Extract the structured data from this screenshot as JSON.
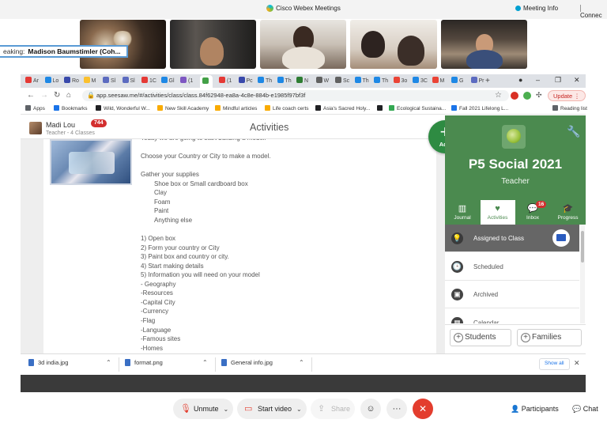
{
  "webex": {
    "title": "Cisco Webex Meetings",
    "meeting_info": "Meeting Info",
    "connection": "Connec",
    "speaking_prefix": "eaking:",
    "speaking_name": "Madison Baumstimler (Coh..."
  },
  "browser": {
    "tabs": [
      {
        "label": "Ar",
        "color": "#e53935"
      },
      {
        "label": "Lo",
        "color": "#1e88e5"
      },
      {
        "label": "Ro",
        "color": "#3949ab"
      },
      {
        "label": "M",
        "color": "#fbc02d"
      },
      {
        "label": "Sl",
        "color": "#5c6bc0"
      },
      {
        "label": "Sl",
        "color": "#5c6bc0"
      },
      {
        "label": "1C",
        "color": "#e53935"
      },
      {
        "label": "Gl",
        "color": "#1e88e5"
      },
      {
        "label": "(1",
        "color": "#7e57c2"
      },
      {
        "label": "",
        "color": "#43a047"
      },
      {
        "label": "(1",
        "color": "#e53935"
      },
      {
        "label": "Pc",
        "color": "#3949ab"
      },
      {
        "label": "Th",
        "color": "#1e88e5"
      },
      {
        "label": "Th",
        "color": "#1e88e5"
      },
      {
        "label": "N",
        "color": "#2e7d32"
      },
      {
        "label": "W",
        "color": "#616161"
      },
      {
        "label": "Sc",
        "color": "#616161"
      },
      {
        "label": "Th",
        "color": "#1e88e5"
      },
      {
        "label": "Th",
        "color": "#1e88e5"
      },
      {
        "label": "3o",
        "color": "#ea4335"
      },
      {
        "label": "3C",
        "color": "#1e88e5"
      },
      {
        "label": "M",
        "color": "#ea4335"
      },
      {
        "label": "G",
        "color": "#1e88e5"
      },
      {
        "label": "Pr",
        "color": "#5c6bc0"
      }
    ],
    "new_tab": "+",
    "url": "app.seesaw.me/#/activities/class/class.84f62948-ea8a-4c8e-884b-e1985f97bf3f",
    "update_label": "Update",
    "bookmarks": [
      {
        "label": "Apps",
        "color": "#5f6368"
      },
      {
        "label": "Bookmarks",
        "color": "#1a73e8"
      },
      {
        "label": "Wild, Wonderful W...",
        "color": "#202124"
      },
      {
        "label": "New Skill Academy",
        "color": "#f9ab00"
      },
      {
        "label": "Mindful articles",
        "color": "#f9ab00"
      },
      {
        "label": "Life coach certs",
        "color": "#f9ab00"
      },
      {
        "label": "Asia's Sacred Holy...",
        "color": "#202124"
      },
      {
        "label": "",
        "color": "#202124"
      },
      {
        "label": "Ecological Sustaina...",
        "color": "#34a853"
      },
      {
        "label": "Fall 2021 Lifelong L...",
        "color": "#1a73e8"
      }
    ],
    "reading_list": "Reading list"
  },
  "seesaw": {
    "user_name": "Madi Lou",
    "user_classes": "Teacher - 4 Classes",
    "notif_count": "744",
    "page_title": "Activities",
    "add_label": "Add",
    "activity_lines": [
      "Today we are going to start building a model.",
      "",
      "Choose your Country or City to make a model.",
      "",
      "Gather your supplies",
      "Shoe box or Small cardboard box",
      "Clay",
      "Foam",
      "Paint",
      "Anything else",
      "",
      "1) Open box",
      "2) Form your country or City",
      "3) Paint box and country or city.",
      "4) Start making details",
      "5) Information you will need on your model",
      "- Geography",
      "-Resources",
      "-Capital City",
      "-Currency",
      "-Flag",
      "-Language",
      "-Famous sites",
      "-Homes"
    ],
    "class_name": "P5 Social 2021",
    "role": "Teacher",
    "tabs": [
      {
        "label": "Journal",
        "icon": "journal-icon"
      },
      {
        "label": "Activities",
        "icon": "activities-icon"
      },
      {
        "label": "Inbox",
        "icon": "inbox-icon",
        "badge": "16"
      },
      {
        "label": "Progress",
        "icon": "progress-icon"
      }
    ],
    "list": [
      {
        "label": "Assigned to Class",
        "icon": "lightbulb-icon"
      },
      {
        "label": "Scheduled",
        "icon": "clock-icon"
      },
      {
        "label": "Archived",
        "icon": "archive-icon"
      },
      {
        "label": "Calendar",
        "icon": "calendar-icon"
      }
    ],
    "students_label": "Students",
    "families_label": "Families"
  },
  "downloads": {
    "files": [
      "3d india.jpg",
      "format.png",
      "General info.jpg"
    ],
    "show_all": "Show all"
  },
  "controls": {
    "unmute": "Unmute",
    "start_video": "Start video",
    "share": "Share",
    "participants": "Participants",
    "chat": "Chat"
  }
}
